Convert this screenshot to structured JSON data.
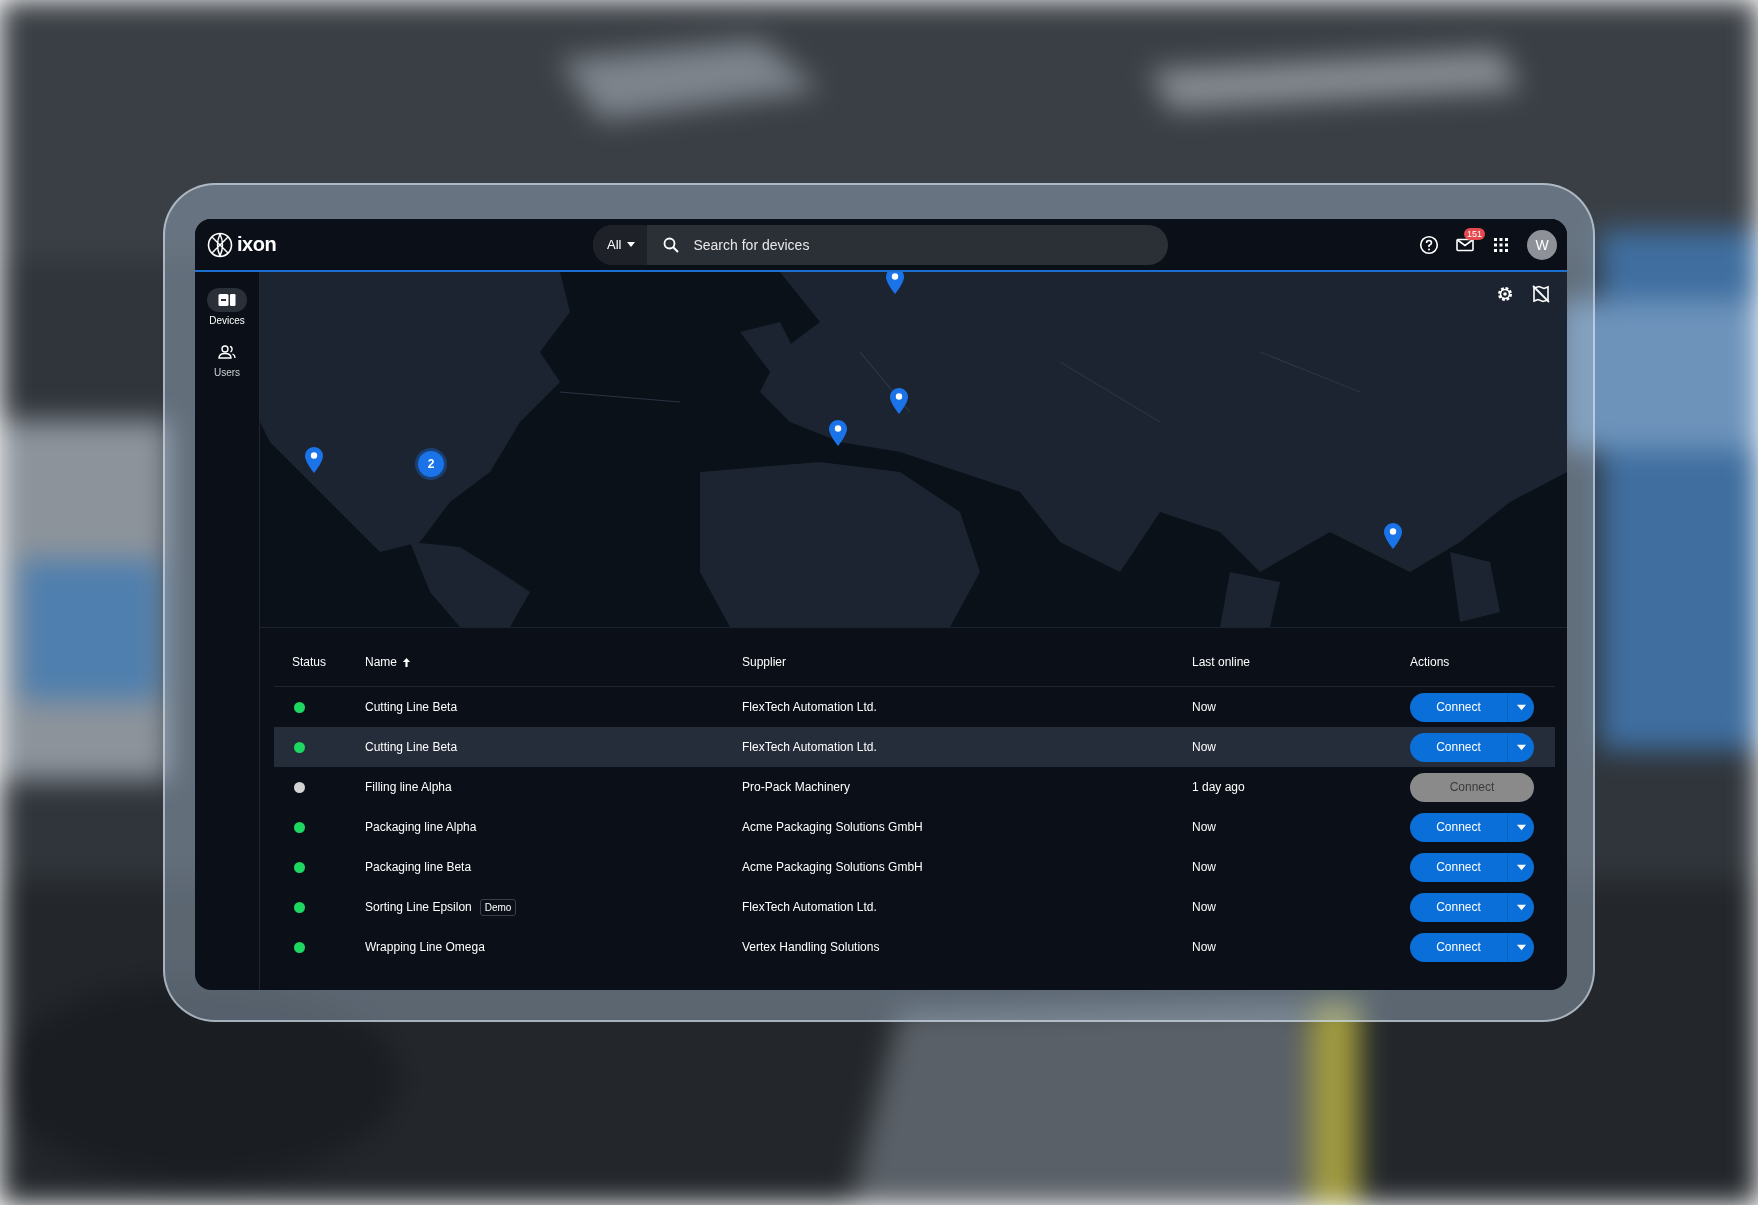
{
  "header": {
    "logo": "ixon",
    "scope": "All",
    "search_placeholder": "Search for devices",
    "notifications_badge": "151",
    "avatar": "W"
  },
  "sidebar": {
    "items": [
      {
        "kind": "devices",
        "label": "Devices",
        "selected": true
      },
      {
        "kind": "users",
        "label": "Users",
        "selected": false
      }
    ]
  },
  "map": {
    "kind": "picture",
    "cluster_count": "2"
  },
  "table": {
    "columns": [
      {
        "label": "Status",
        "sorted": false
      },
      {
        "label": "Name",
        "sorted": true
      },
      {
        "label": "Supplier",
        "sorted": false
      },
      {
        "label": "Last online",
        "sorted": false
      },
      {
        "label": "Actions",
        "sorted": false
      }
    ],
    "rows": [
      {
        "online": true,
        "name": "Cutting Line Beta",
        "supplier": "FlexTech Automation Ltd.",
        "last_online": "Now",
        "action": "Connect",
        "disabled": false,
        "selected": false
      },
      {
        "online": true,
        "name": "Cutting Line Beta",
        "supplier": "FlexTech Automation Ltd.",
        "last_online": "Now",
        "action": "Connect",
        "disabled": false,
        "selected": true
      },
      {
        "online": false,
        "name": "Filling line Alpha",
        "supplier": "Pro-Pack Machinery",
        "last_online": "1 day ago",
        "action": "Connect",
        "disabled": true,
        "selected": false
      },
      {
        "online": true,
        "name": "Packaging line Alpha",
        "supplier": "Acme Packaging Solutions GmbH",
        "last_online": "Now",
        "action": "Connect",
        "disabled": false,
        "selected": false
      },
      {
        "online": true,
        "name": "Packaging line Beta",
        "supplier": "Acme Packaging Solutions GmbH",
        "last_online": "Now",
        "action": "Connect",
        "disabled": false,
        "selected": false
      },
      {
        "online": true,
        "name": "Sorting Line Epsilon",
        "tag": "Demo",
        "supplier": "FlexTech Automation Ltd.",
        "last_online": "Now",
        "action": "Connect",
        "disabled": false,
        "selected": false
      },
      {
        "online": true,
        "name": "Wrapping Line Omega",
        "supplier": "Vertex Handling Solutions",
        "last_online": "Now",
        "action": "Connect",
        "disabled": false,
        "selected": false
      }
    ]
  }
}
